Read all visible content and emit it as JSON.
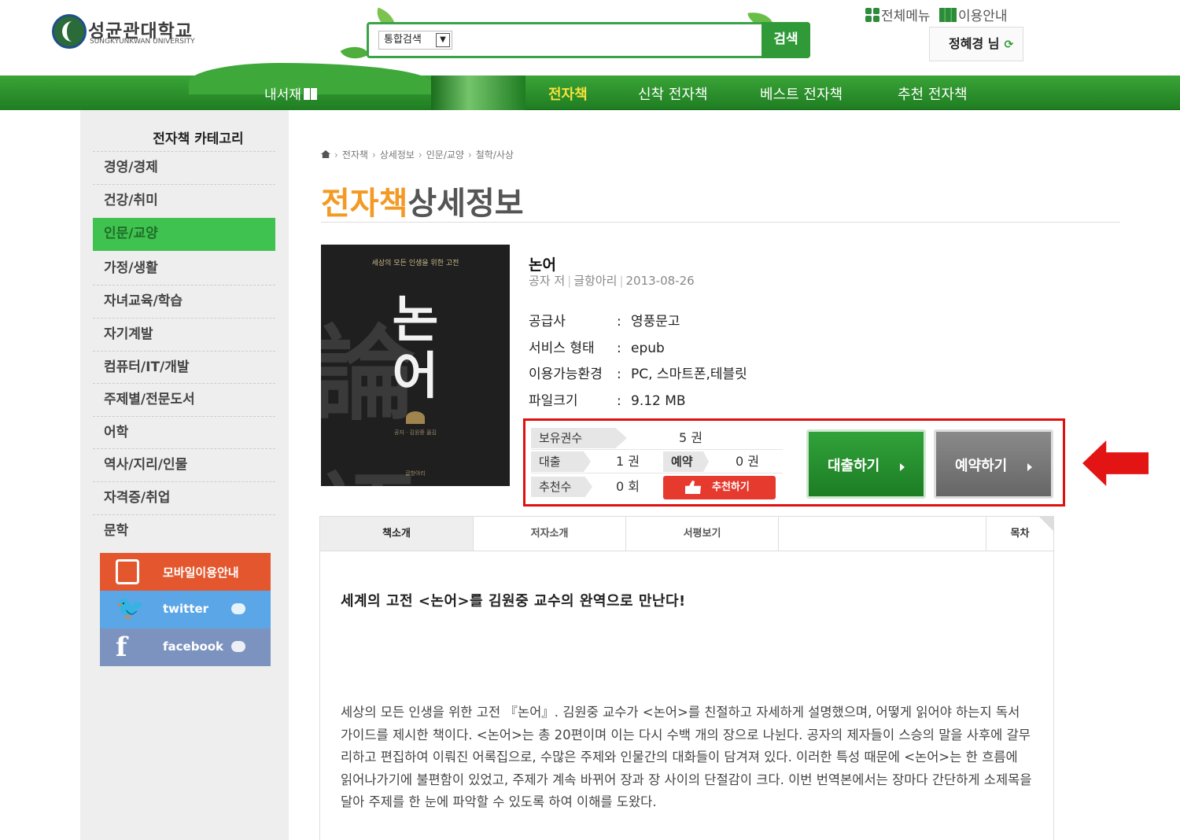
{
  "header": {
    "logo_kr": "성균관대학교",
    "logo_en": "SUNGKYUNKWAN UNIVERSITY",
    "search_scope": "통합검색",
    "search_button": "검색",
    "util_menu": "전체메뉴",
    "util_guide": "이용안내",
    "user_name": "정혜경 님",
    "logout_symbol": "⟳"
  },
  "nav": {
    "my_library": "내서재",
    "items": [
      "전자책",
      "신착 전자책",
      "베스트 전자책",
      "추천 전자책"
    ],
    "active_index": 0
  },
  "sidebar": {
    "title": "전자책 카테고리",
    "items": [
      "경영/경제",
      "건강/취미",
      "인문/교양",
      "가정/생활",
      "자녀교육/학습",
      "자기계발",
      "컴퓨터/IT/개발",
      "주제별/전문도서",
      "어학",
      "역사/지리/인물",
      "자격증/취업",
      "문학"
    ],
    "active_index": 2,
    "mobile_label": "모바일이용안내",
    "twitter_label": "twitter",
    "facebook_label": "facebook"
  },
  "breadcrumb": [
    "전자책",
    "상세정보",
    "인문/교양",
    "철학/사상"
  ],
  "page_title": {
    "accent": "전자책",
    "rest": "상세정보"
  },
  "cover": {
    "subtitle": "세상의 모든 인생을 위한 고전",
    "title": "논어",
    "author": "공자 · 김원중 옮김",
    "publisher": "글항아리"
  },
  "book": {
    "title": "논어",
    "author": "공자 저",
    "publisher": "글항아리",
    "date": "2013-08-26",
    "info": [
      {
        "key": "공급사",
        "value": "영풍문고"
      },
      {
        "key": "서비스 형태",
        "value": "epub"
      },
      {
        "key": "이용가능환경",
        "value": "PC, 스마트폰,테블릿"
      },
      {
        "key": "파일크기",
        "value": "9.12 MB"
      }
    ]
  },
  "stats": {
    "owned_label": "보유권수",
    "owned_value": "5 권",
    "loan_label": "대출",
    "loan_value": "1 권",
    "reserve_label": "예약",
    "reserve_value": "0 권",
    "recommend_label": "추천수",
    "recommend_value": "0 회",
    "recommend_button": "추천하기"
  },
  "actions": {
    "borrow": "대출하기",
    "reserve": "예약하기"
  },
  "tabs": [
    "책소개",
    "저자소개",
    "서평보기"
  ],
  "toc_tab": "목차",
  "intro": {
    "headline": "세계의 고전 <논어>를 김원중 교수의 완역으로 만난다!",
    "paragraph": "세상의 모든 인생을 위한 고전 『논어』. 김원중 교수가 <논어>를 친절하고 자세하게 설명했으며, 어떻게 읽어야 하는지 독서 가이드를 제시한 책이다. <논어>는 총 20편이며 이는 다시 수백 개의 장으로 나뉜다. 공자의 제자들이 스승의 말을 사후에 갈무리하고 편집하여 이뤄진 어록집으로, 수많은 주제와 인물간의 대화들이 담겨져 있다. 이러한 특성 때문에 <논어>는 한 흐름에 읽어나가기에 불편함이 있었고, 주제가 계속 바뀌어 장과 장 사이의 단절감이 크다. 이번 번역본에서는 장마다 간단하게 소제목을 달아 주제를 한 눈에 파악할 수 있도록 하여 이해를 도왔다."
  }
}
